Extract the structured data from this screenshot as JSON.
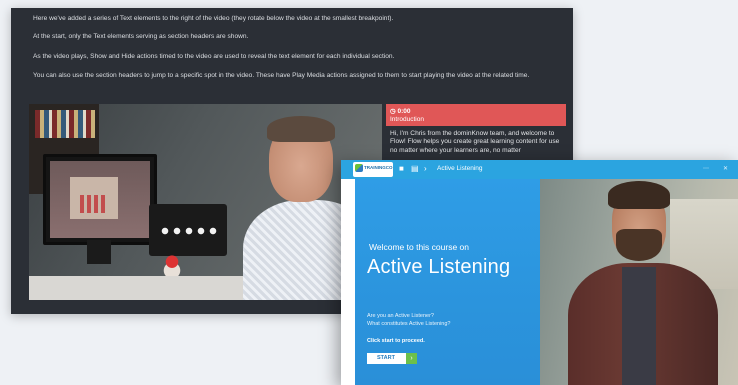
{
  "colors": {
    "dark_panel": "#2b2f36",
    "caption_accent": "#e05757",
    "app_blue": "#2ba4e0",
    "start_arrow": "#6cc04a"
  },
  "back_panel": {
    "paragraphs": [
      "Here we've added a series of Text elements to the right of the video (they rotate below the video at the smallest breakpoint).",
      "At the start, only the Text elements serving as section headers are shown.",
      "As the video plays, Show and Hide actions timed to the video are used to reveal the text element for each individual section.",
      "You can also use the section headers to jump to a specific spot in the video. These have Play Media actions assigned to them to start playing the video at the related time."
    ],
    "caption": {
      "time": "0:00",
      "title": "Introduction",
      "text": "Hi, I'm Chris from the dominKnow team, and welcome to Flow! Flow helps you create great learning content for use no matter where your learners are, no matter"
    }
  },
  "front_panel": {
    "logo_text": "TRAININGCO",
    "course_title": "Active Listening",
    "welcome": "Welcome to this course on",
    "title": "Active Listening",
    "questions": [
      "Are you an Active Listener?",
      "What constitutes Active Listening?"
    ],
    "hint": "Click start to proceed.",
    "start_label": "START",
    "icons": [
      "menu-icon",
      "resources-icon",
      "next-icon",
      "settings-icon",
      "close-icon"
    ]
  }
}
